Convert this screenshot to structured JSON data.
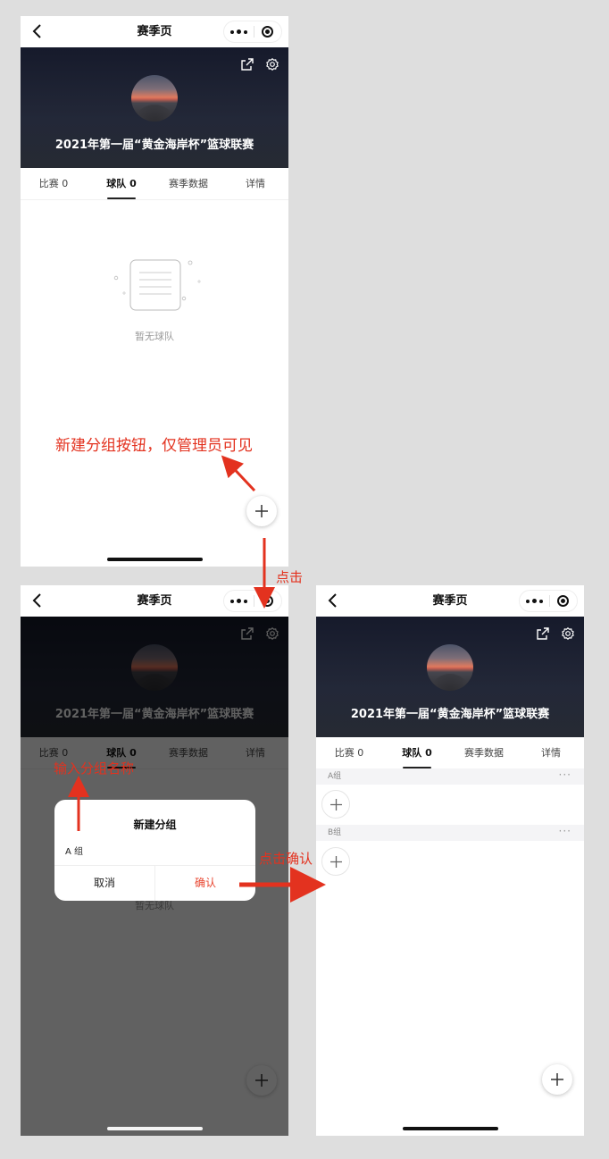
{
  "colors": {
    "accent": "#e3321f",
    "confirm": "#e8432d",
    "background": "#dedede"
  },
  "nav": {
    "title": "赛季页"
  },
  "hero": {
    "title": "2021年第一届“黄金海岸杯”篮球联赛"
  },
  "tabs": [
    {
      "label": "比赛 0"
    },
    {
      "label": "球队 0"
    },
    {
      "label": "赛季数据"
    },
    {
      "label": "详情"
    }
  ],
  "empty": {
    "text": "暂无球队"
  },
  "dialog": {
    "title": "新建分组",
    "input_value": "A 组",
    "cancel_label": "取消",
    "confirm_label": "确认"
  },
  "groups": [
    {
      "name": "A组",
      "more": "···"
    },
    {
      "name": "B组",
      "more": "···"
    }
  ],
  "notes": {
    "fab_note": "新建分组按钮，仅管理员可见",
    "click": "点击",
    "input_note": "输入分组名称",
    "confirm_note": "点击确认"
  },
  "icons": [
    "back-icon",
    "more-icon",
    "target-icon",
    "share-icon",
    "gear-icon",
    "plus-icon",
    "empty-list-icon"
  ]
}
